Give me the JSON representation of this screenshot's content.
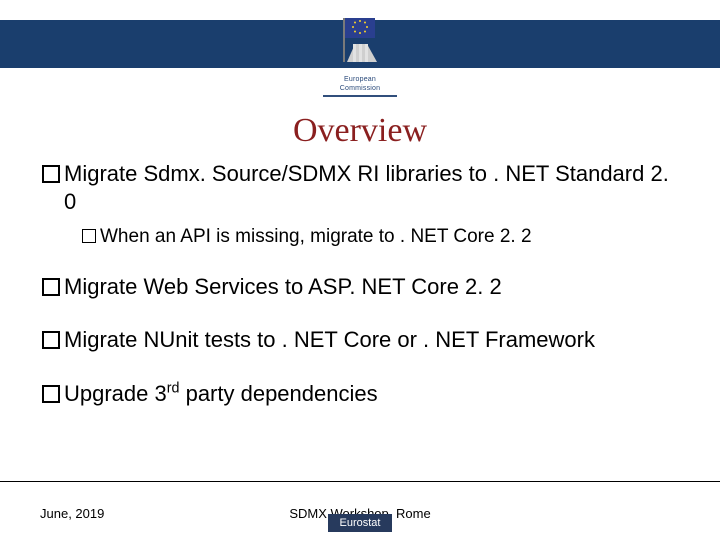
{
  "logo": {
    "line1": "European",
    "line2": "Commission"
  },
  "title": "Overview",
  "bullets": {
    "b1": "Migrate Sdmx. Source/SDMX RI libraries to . NET Standard 2. 0",
    "b1_sub": "When an API is missing, migrate to . NET Core 2. 2",
    "b2": "Migrate Web Services to ASP. NET Core 2. 2",
    "b3": "Migrate NUnit tests to . NET Core or . NET Framework",
    "b4_pre": "Upgrade 3",
    "b4_sup": "rd",
    "b4_post": " party dependencies"
  },
  "footer": {
    "date": "June, 2019",
    "center": "SDMX Workshop, Rome",
    "badge": "Eurostat"
  }
}
